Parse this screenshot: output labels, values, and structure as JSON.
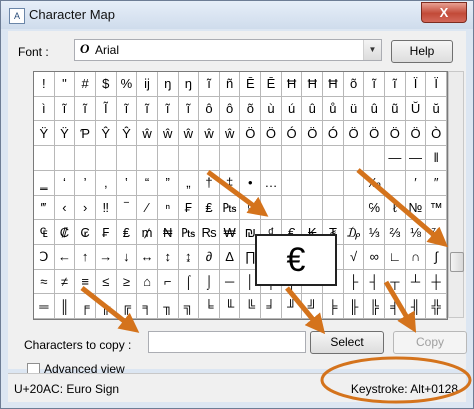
{
  "window": {
    "title": "Character Map",
    "close_glyph": "X"
  },
  "font_row": {
    "label": "Font :",
    "value": "Arial",
    "help_label": "Help"
  },
  "grid": {
    "rows": [
      [
        "!",
        "\"",
        "#",
        "$",
        "%",
        "ĳ",
        "ŋ",
        "ŋ",
        "ĩ",
        "ñ",
        "Ē",
        "Ē",
        "Ħ",
        "Ħ",
        "Ħ",
        "õ",
        "ĩ",
        "ĩ",
        "Ï",
        "Ï"
      ],
      [
        "ì",
        "ĩ",
        "ĩ",
        "Ĩ",
        "ĩ",
        "ĩ",
        "ĩ",
        "ĩ",
        "ô",
        "ô",
        "õ",
        "ù",
        "ú",
        "û",
        "ů",
        "ü",
        "û",
        "ũ",
        "Ŭ",
        "ŭ"
      ],
      [
        "Ÿ",
        "Ÿ",
        "Ƥ",
        "Ŷ",
        "Ŷ",
        "ŵ",
        "ŵ",
        "ŵ",
        "ŵ",
        "ŵ",
        "Ö",
        "Ö",
        "Ó",
        "Ö",
        "Ó",
        "Ö",
        "Ö",
        "Ö",
        "Ö",
        "Ò"
      ],
      [
        "",
        "",
        "",
        "",
        "",
        "",
        "",
        "",
        "",
        "",
        "",
        "",
        "",
        "",
        "",
        "",
        "",
        "—",
        "—",
        "‖"
      ],
      [
        "‗",
        "‘",
        "’",
        "‚",
        "‛",
        "“",
        "”",
        "„",
        "†",
        "‡",
        "•",
        "…",
        "",
        "",
        "",
        "",
        "‰",
        "",
        "′",
        "″"
      ],
      [
        "‴",
        "‹",
        "›",
        "‼",
        "‾",
        "⁄",
        "ⁿ",
        "₣",
        "₤",
        "₧",
        "₫",
        "",
        "",
        "",
        "",
        "",
        "℅",
        "ℓ",
        "№",
        "™"
      ],
      [
        "₠",
        "₡",
        "₢",
        "₣",
        "₤",
        "₥",
        "₦",
        "₧",
        "₨",
        "₩",
        "₪",
        "₫",
        "€",
        "₭",
        "₮",
        "₯",
        "⅓",
        "⅔",
        "⅛",
        "⅞"
      ],
      [
        "Ↄ",
        "←",
        "↑",
        "→",
        "↓",
        "↔",
        "↕",
        "↨",
        "∂",
        "∆",
        "∏",
        "∑",
        "−",
        "∕",
        "∙",
        "√",
        "∞",
        "∟",
        "∩",
        "∫"
      ],
      [
        "≈",
        "≠",
        "≡",
        "≤",
        "≥",
        "⌂",
        "⌐",
        "⌠",
        "⌡",
        "─",
        "│",
        "┌",
        "┐",
        "└",
        "┘",
        "├",
        "┤",
        "┬",
        "┴",
        "┼"
      ],
      [
        "═",
        "║",
        "╒",
        "╓",
        "╔",
        "╕",
        "╖",
        "╗",
        "╘",
        "╙",
        "╚",
        "╛",
        "╜",
        "╝",
        "╞",
        "╟",
        "╠",
        "╡",
        "╢",
        "╬"
      ]
    ],
    "zoom_char": "€"
  },
  "copy_row": {
    "label": "Characters to copy :",
    "value": "",
    "select_label": "Select",
    "copy_label": "Copy"
  },
  "advanced": {
    "label": "Advanced view",
    "checked": false
  },
  "status": {
    "char_info": "U+20AC: Euro Sign",
    "keystroke": "Keystroke: Alt+0128"
  },
  "colors": {
    "annotation": "#d4731c",
    "window_frame": "#dce6f2",
    "close_button": "#c24a38"
  }
}
